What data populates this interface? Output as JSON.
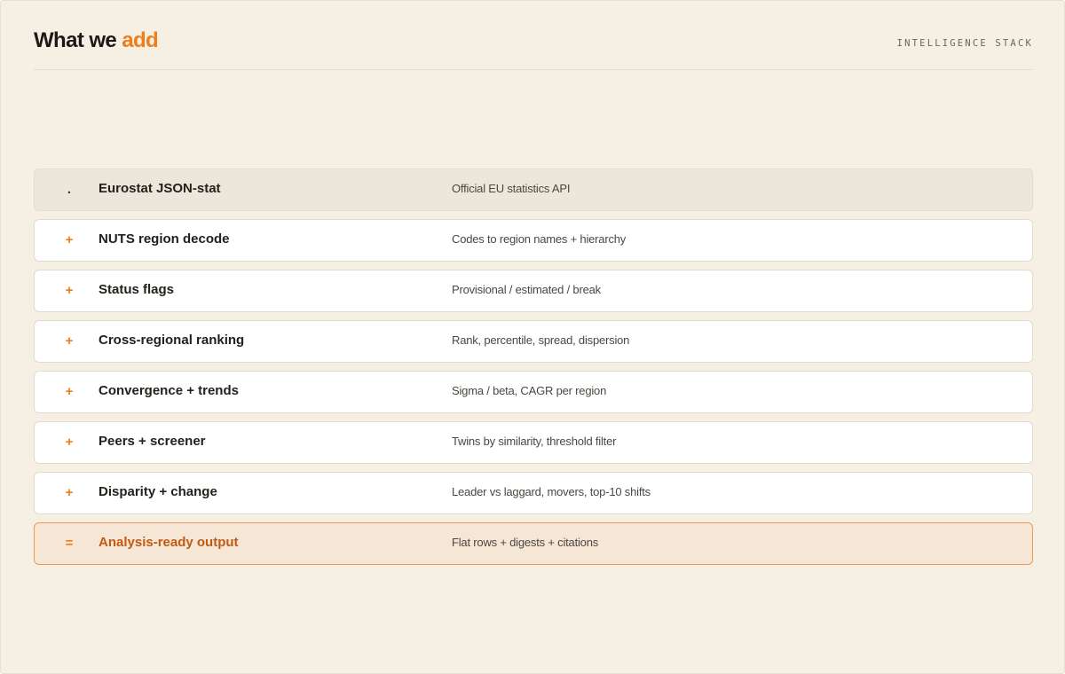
{
  "header": {
    "title_main": "What we ",
    "title_accent": "add",
    "kicker": "INTELLIGENCE STACK"
  },
  "colors": {
    "background": "#f5efe4",
    "accent": "#ef7d1a",
    "output_text": "#c25a12",
    "output_border": "#ef9a4a",
    "output_fill": "#f6e6d6",
    "source_fill": "#ede6da"
  },
  "stack": [
    {
      "symbol": ".",
      "name": "Eurostat JSON-stat",
      "description": "Official EU statistics API"
    },
    {
      "symbol": "+",
      "name": "NUTS region decode",
      "description": "Codes to region names + hierarchy"
    },
    {
      "symbol": "+",
      "name": "Status flags",
      "description": "Provisional / estimated / break"
    },
    {
      "symbol": "+",
      "name": "Cross-regional ranking",
      "description": "Rank, percentile, spread, dispersion"
    },
    {
      "symbol": "+",
      "name": "Convergence + trends",
      "description": "Sigma / beta, CAGR per region"
    },
    {
      "symbol": "+",
      "name": "Peers + screener",
      "description": "Twins by similarity, threshold filter"
    },
    {
      "symbol": "+",
      "name": "Disparity + change",
      "description": "Leader vs laggard, movers, top-10 shifts"
    },
    {
      "symbol": "=",
      "name": "Analysis-ready output",
      "description": "Flat rows + digests + citations"
    }
  ]
}
